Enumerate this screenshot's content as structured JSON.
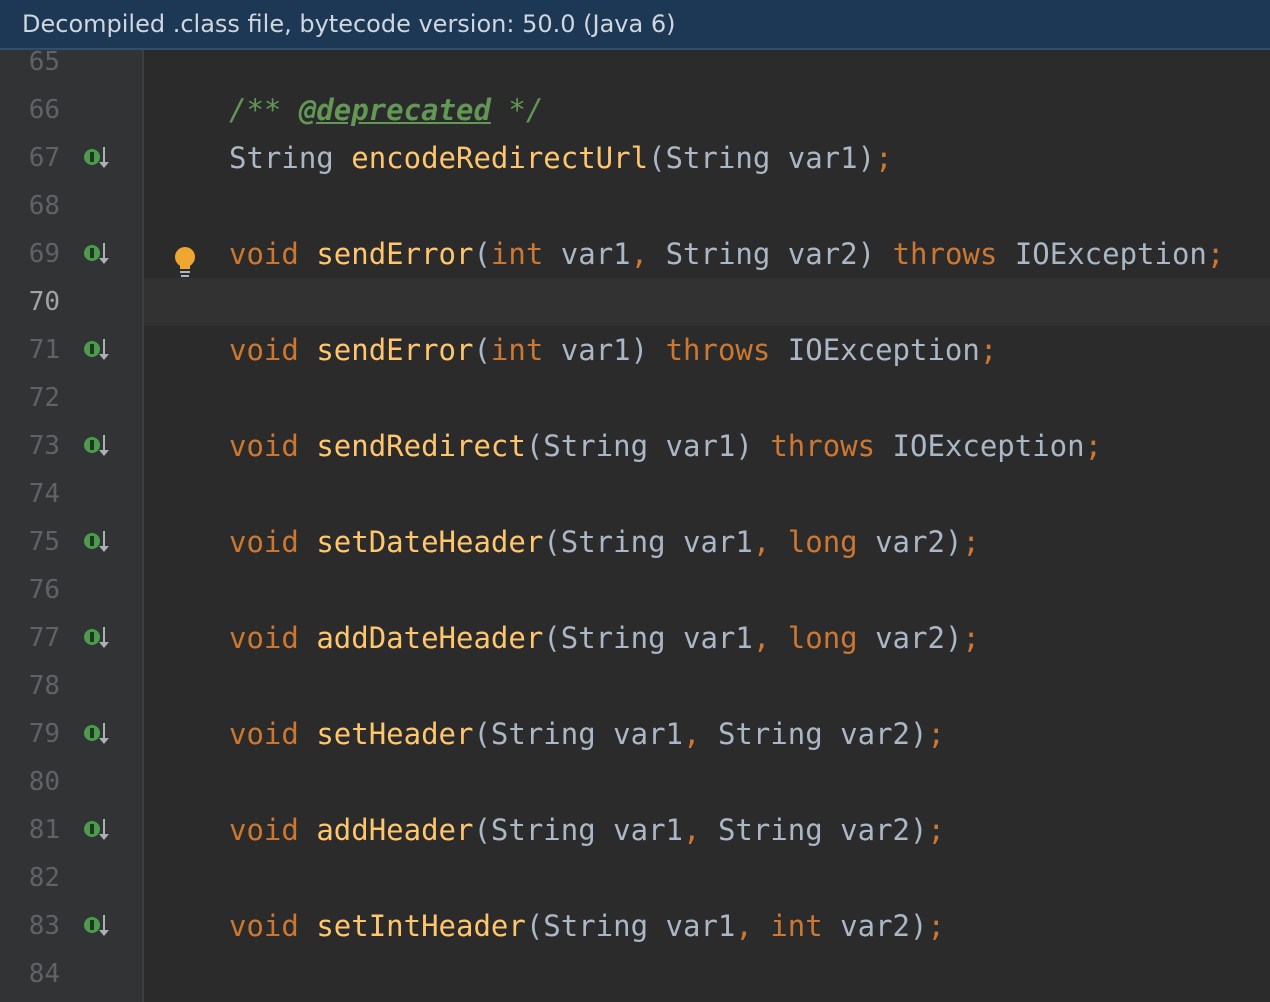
{
  "banner": {
    "text": "Decompiled .class file, bytecode version: 50.0 (Java 6)"
  },
  "editor": {
    "line_numbers": [
      "65",
      "66",
      "67",
      "68",
      "69",
      "70",
      "71",
      "72",
      "73",
      "74",
      "75",
      "76",
      "77",
      "78",
      "79",
      "80",
      "81",
      "82",
      "83",
      "84"
    ],
    "current_line": "70",
    "implemented_icon_lines": [
      "67",
      "69",
      "71",
      "73",
      "75",
      "77",
      "79",
      "81",
      "83"
    ],
    "code": {
      "l66": {
        "open": "/** ",
        "tag": "@deprecated",
        "close": " */"
      },
      "l67": [
        "String",
        " ",
        "encodeRedirectUrl",
        "(",
        "String",
        " ",
        "var1",
        ")",
        ";"
      ],
      "l69": [
        "void",
        " ",
        "sendError",
        "(",
        "int",
        " ",
        "var1",
        ",",
        " ",
        "String",
        " ",
        "var2",
        ")",
        " ",
        "throws",
        " ",
        "IOException",
        ";"
      ],
      "l71": [
        "void",
        " ",
        "sendError",
        "(",
        "int",
        " ",
        "var1",
        ")",
        " ",
        "throws",
        " ",
        "IOException",
        ";"
      ],
      "l73": [
        "void",
        " ",
        "sendRedirect",
        "(",
        "String",
        " ",
        "var1",
        ")",
        " ",
        "throws",
        " ",
        "IOException",
        ";"
      ],
      "l75": [
        "void",
        " ",
        "setDateHeader",
        "(",
        "String",
        " ",
        "var1",
        ",",
        " ",
        "long",
        " ",
        "var2",
        ")",
        ";"
      ],
      "l77": [
        "void",
        " ",
        "addDateHeader",
        "(",
        "String",
        " ",
        "var1",
        ",",
        " ",
        "long",
        " ",
        "var2",
        ")",
        ";"
      ],
      "l79": [
        "void",
        " ",
        "setHeader",
        "(",
        "String",
        " ",
        "var1",
        ",",
        " ",
        "String",
        " ",
        "var2",
        ")",
        ";"
      ],
      "l81": [
        "void",
        " ",
        "addHeader",
        "(",
        "String",
        " ",
        "var1",
        ",",
        " ",
        "String",
        " ",
        "var2",
        ")",
        ";"
      ],
      "l83": [
        "void",
        " ",
        "setIntHeader",
        "(",
        "String",
        " ",
        "var1",
        ",",
        " ",
        "int",
        " ",
        "var2",
        ")",
        ";"
      ]
    }
  },
  "colors": {
    "background": "#2b2b2b",
    "gutter": "#313335",
    "banner": "#1d3854",
    "keyword": "#cc7832",
    "method": "#ffc66d",
    "identifier": "#a9b7c6",
    "doc_comment": "#629755",
    "implemented_icon": "#4e9a4e",
    "bulb": "#f0a732"
  },
  "icons": {
    "implemented": "implemented-method-icon",
    "intention": "lightbulb-icon"
  }
}
